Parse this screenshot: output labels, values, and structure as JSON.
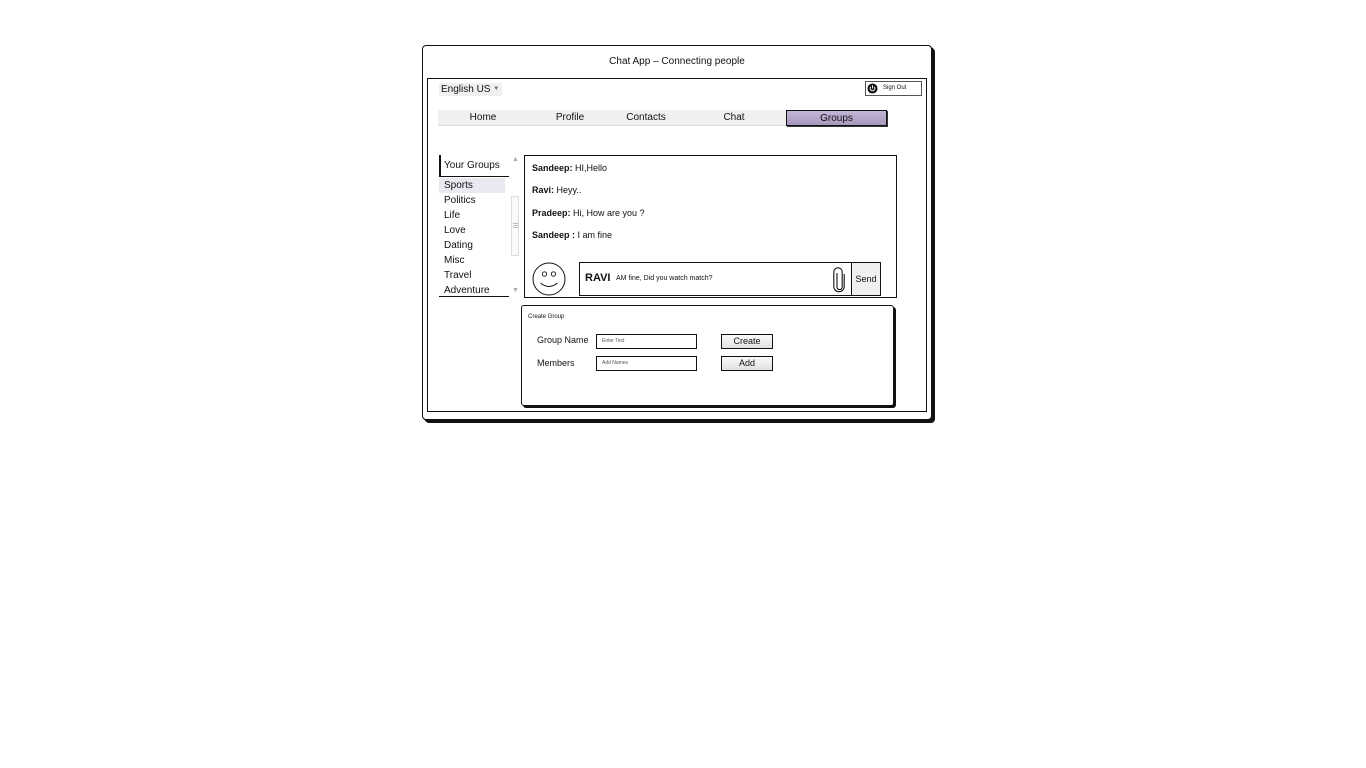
{
  "window": {
    "title": "Chat App – Connecting people"
  },
  "header": {
    "language": "English US",
    "signout_label": "Sign Out"
  },
  "nav": {
    "tabs": [
      {
        "label": "Home",
        "active": false
      },
      {
        "label": "Profile",
        "active": false
      },
      {
        "label": "Contacts",
        "active": false
      },
      {
        "label": "Chat",
        "active": false
      },
      {
        "label": "Groups",
        "active": true
      }
    ]
  },
  "sidebar": {
    "header": "Your Groups",
    "selected": "Sports",
    "items": [
      "Sports",
      "Politics",
      "Life",
      "Love",
      "Dating",
      "Misc",
      "Travel",
      "Adventure"
    ]
  },
  "chat": {
    "messages": [
      {
        "sender": "Sandeep:",
        "text": "HI,Hello"
      },
      {
        "sender": "Ravi:",
        "text": "Heyy.."
      },
      {
        "sender": "Pradeep:",
        "text": "Hi, How are you ?"
      },
      {
        "sender": "Sandeep :",
        "text": "I am fine"
      }
    ],
    "composer": {
      "sender": "RAVI",
      "text": "AM fine, Did you watch match?",
      "send_label": "Send"
    }
  },
  "create_group": {
    "title": "Create Group",
    "group_name_label": "Group Name",
    "group_name_placeholder": "Enter Text",
    "create_label": "Create",
    "members_label": "Members",
    "members_placeholder": "Add Names",
    "add_label": "Add"
  },
  "colors": {
    "active_tab": "#b3a6c9",
    "selected_item": "#ebe8f1"
  },
  "icons": {
    "signout": "power-icon",
    "avatar": "smiley-icon",
    "attach": "paperclip-icon"
  }
}
